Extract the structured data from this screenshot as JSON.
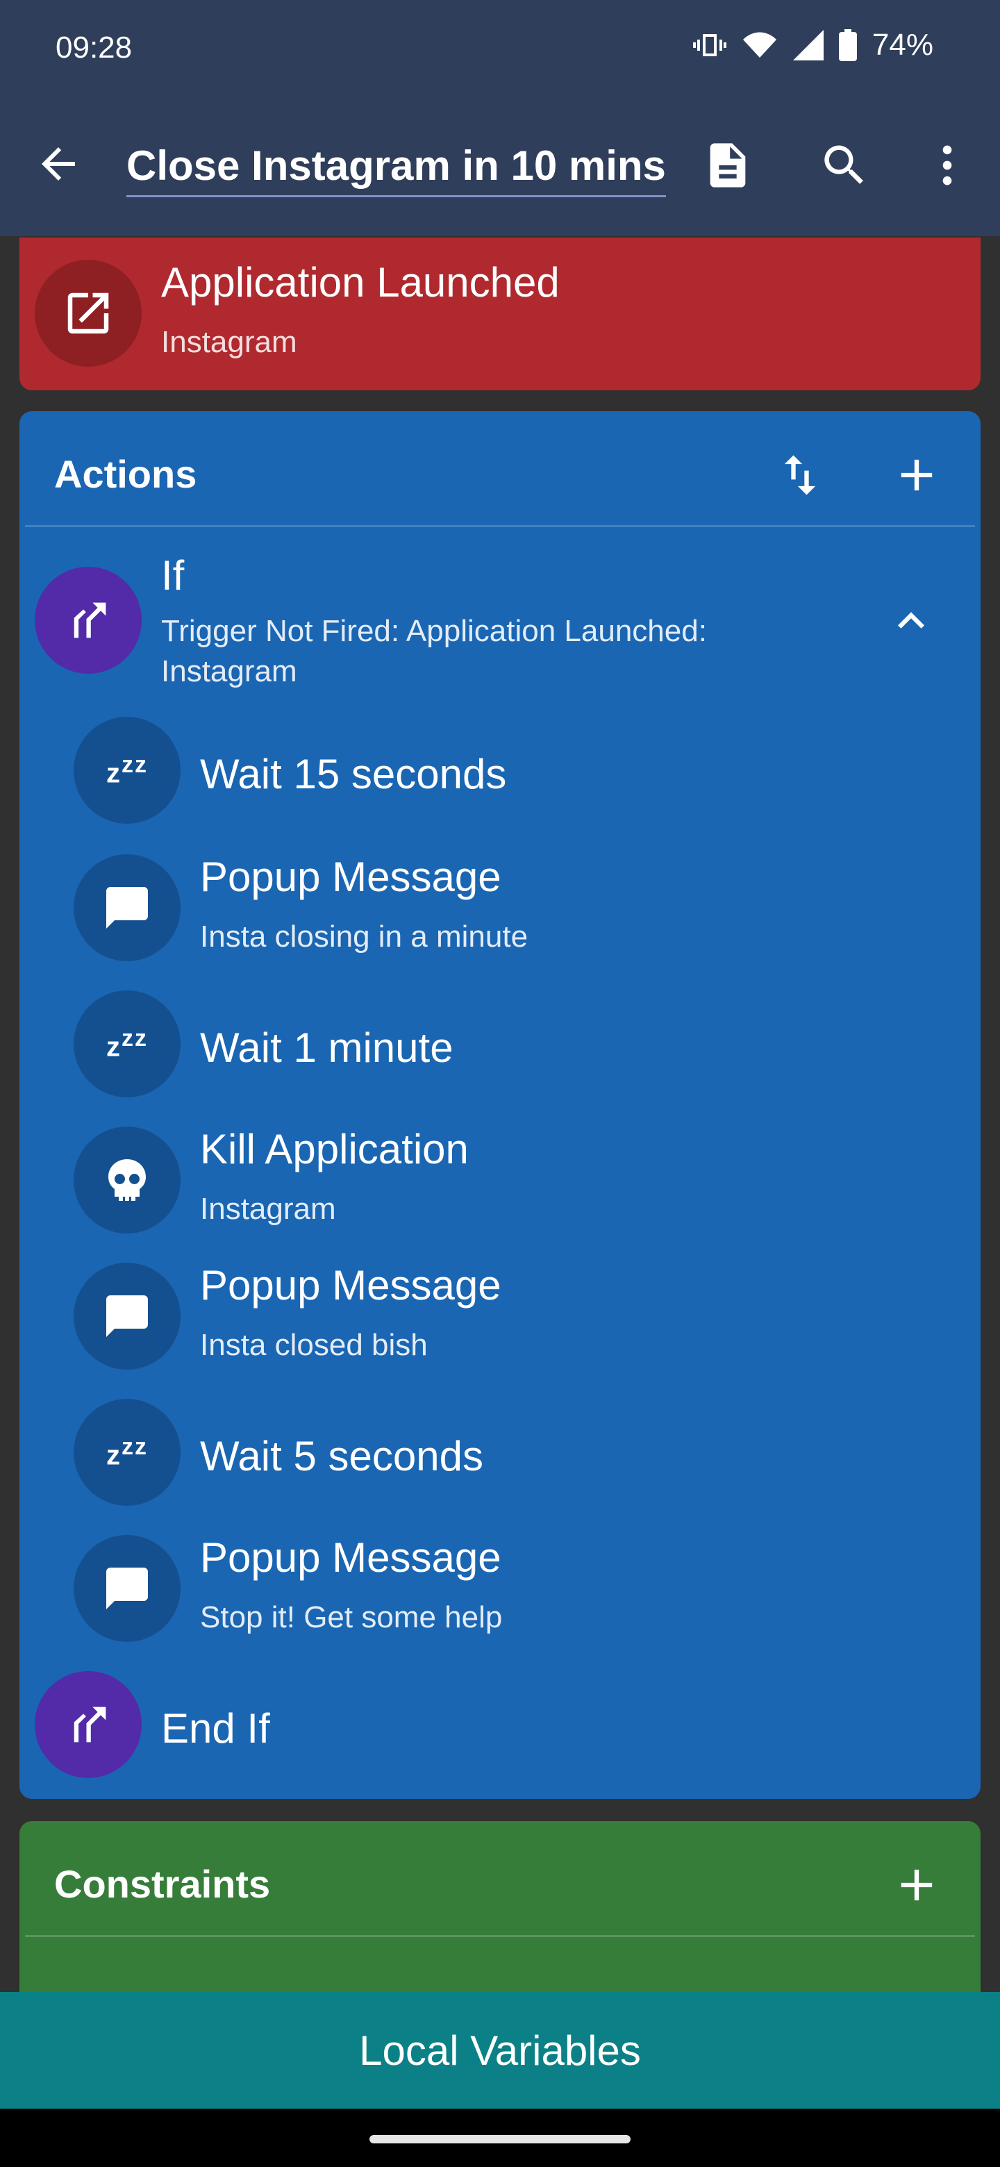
{
  "status_bar": {
    "time": "09:28",
    "battery": "74%"
  },
  "app_bar": {
    "title": "Close Instagram in 10 mins"
  },
  "trigger": {
    "title": "Application Launched",
    "subtitle": "Instagram"
  },
  "actions": {
    "header": "Actions",
    "if_block": {
      "title": "If",
      "subtitle_line1": "Trigger Not Fired: Application Launched:",
      "subtitle_line2": "Instagram"
    },
    "items": [
      {
        "title": "Wait 15 seconds",
        "icon": "sleep-icon"
      },
      {
        "title": "Popup Message",
        "subtitle": "Insta closing in a minute",
        "icon": "message-icon"
      },
      {
        "title": "Wait 1 minute",
        "icon": "sleep-icon"
      },
      {
        "title": "Kill Application",
        "subtitle": "Instagram",
        "icon": "skull-icon"
      },
      {
        "title": "Popup Message",
        "subtitle": "Insta closed bish",
        "icon": "message-icon"
      },
      {
        "title": "Wait 5 seconds",
        "icon": "sleep-icon"
      },
      {
        "title": "Popup Message",
        "subtitle": "Stop it! Get some help",
        "icon": "message-icon"
      }
    ],
    "end_if": "End If",
    "sleep_glyph": "zzz"
  },
  "constraints": {
    "header": "Constraints"
  },
  "bottom": {
    "local_variables": "Local Variables"
  },
  "colors": {
    "app_bar": "#2f3e5a",
    "trigger_card": "#b0292e",
    "actions_card": "#1a66b3",
    "constraints_card": "#377d3a",
    "local_variables_bar": "#0b8187",
    "if_circle": "#532aa8"
  }
}
